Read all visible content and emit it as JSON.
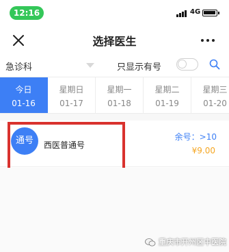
{
  "status_bar": {
    "time": "12:16",
    "network": "4G"
  },
  "nav": {
    "title": "选择医生",
    "close_icon": "close-icon",
    "more_icon": "more-icon"
  },
  "filter": {
    "department": "急诊科",
    "only_available_label": "只显示有号",
    "only_available_checked": false,
    "search_icon": "search-icon"
  },
  "dates": [
    {
      "weekday": "今日",
      "date": "01-16",
      "active": true
    },
    {
      "weekday": "星期日",
      "date": "01-17",
      "active": false
    },
    {
      "weekday": "星期一",
      "date": "01-18",
      "active": false
    },
    {
      "weekday": "星期二",
      "date": "01-19",
      "active": false
    },
    {
      "weekday": "星期三",
      "date": "01-20",
      "active": false
    }
  ],
  "doctors": [
    {
      "avatar_text": "通号",
      "name": "西医普通号",
      "remaining": "余号：>10",
      "price": "¥9.00"
    }
  ],
  "watermark": {
    "text": "重庆市开州区中医院"
  },
  "colors": {
    "accent": "#3d7ff5",
    "price": "#f5a623",
    "highlight": "#d9322e",
    "time_pill": "#34c759"
  }
}
